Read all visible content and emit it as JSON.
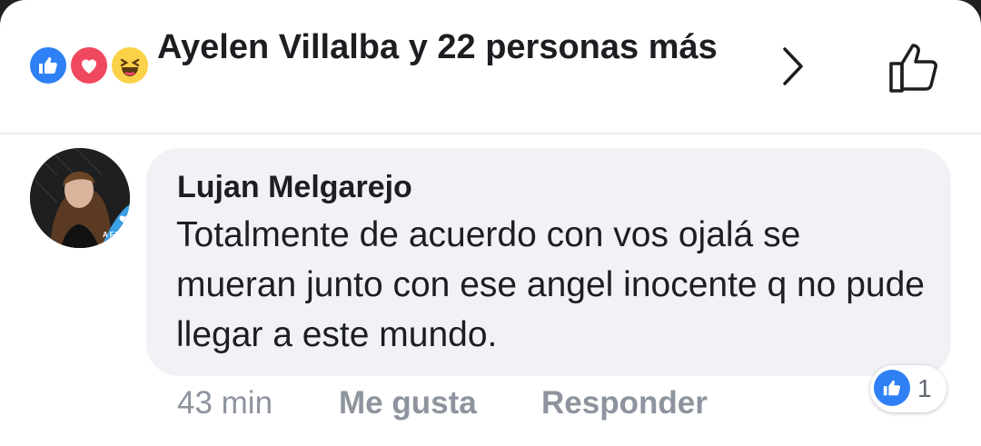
{
  "header": {
    "reaction_summary": "Ayelen Villalba y 22 personas más",
    "reaction_icons": [
      "like-icon",
      "love-icon",
      "haha-icon"
    ]
  },
  "comment": {
    "author": "Lujan Melgarejo",
    "text": "Totalmente de acuerdo con vos ojalá se mueran junto con ese angel inocente q no pude llegar a este mundo.",
    "avatar_badge_text": "A FAV DE LA",
    "time": "43 min",
    "like_label": "Me gusta",
    "reply_label": "Responder",
    "reaction_count": "1"
  },
  "colors": {
    "like_blue": "#2f80f5",
    "love_red": "#f0485f",
    "haha_yellow": "#fbd148",
    "bubble_bg": "#f0f2f5",
    "meta_gray": "#8d949e"
  }
}
